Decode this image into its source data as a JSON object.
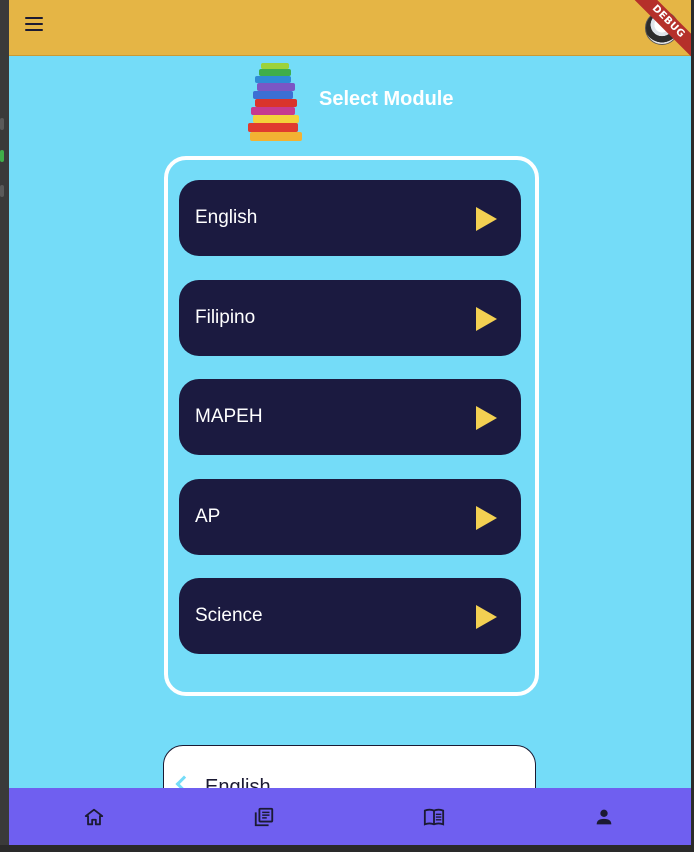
{
  "app": {
    "debug_banner": "DEBUG"
  },
  "header": {
    "menu_icon": "menu-icon",
    "avatar_icon": "avatar-icon"
  },
  "page": {
    "title": "Select Module",
    "title_icon": "books-stack-icon"
  },
  "modules": [
    {
      "label": "English",
      "icon": "play-icon"
    },
    {
      "label": "Filipino",
      "icon": "play-icon"
    },
    {
      "label": "MAPEH",
      "icon": "play-icon"
    },
    {
      "label": "AP",
      "icon": "play-icon"
    },
    {
      "label": "Science",
      "icon": "play-icon"
    }
  ],
  "selected_module": {
    "label": "English",
    "icon": "chevron-left-icon"
  },
  "bottom_nav": [
    {
      "icon": "home-icon"
    },
    {
      "icon": "library-icon"
    },
    {
      "icon": "menu-book-icon"
    },
    {
      "icon": "person-icon"
    }
  ],
  "colors": {
    "appbar": "#e5b545",
    "background": "#74dcf8",
    "module_button": "#1b1a40",
    "play_icon": "#f3d052",
    "bottom_nav": "#6f5ff0"
  }
}
